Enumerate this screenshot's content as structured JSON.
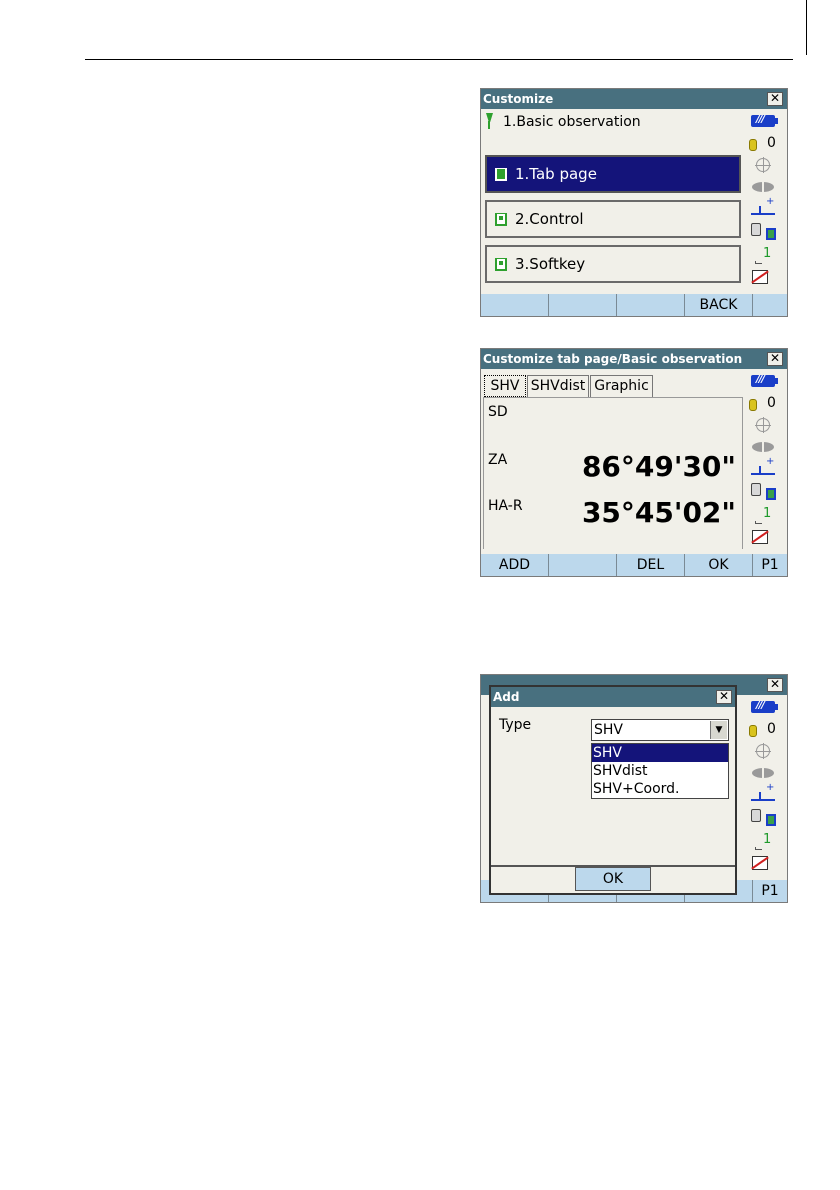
{
  "screen1": {
    "title": "Customize",
    "close_glyph": "✕",
    "header": "1.Basic observation",
    "items": [
      {
        "label": "1.Tab page",
        "selected": true
      },
      {
        "label": "2.Control",
        "selected": false
      },
      {
        "label": "3.Softkey",
        "selected": false
      }
    ],
    "softkeys": [
      "",
      "",
      "",
      "BACK",
      ""
    ]
  },
  "screen2": {
    "title": "Customize tab page/Basic observation",
    "close_glyph": "✕",
    "tabs": [
      "SHV",
      "SHVdist",
      "Graphic"
    ],
    "rows": [
      {
        "label": "SD",
        "value": ""
      },
      {
        "label": "ZA",
        "value": "86°49'30\""
      },
      {
        "label": "HA-R",
        "value": "35°45'02\""
      }
    ],
    "softkeys": [
      "ADD",
      "",
      "DEL",
      "OK",
      "P1"
    ]
  },
  "screen3": {
    "close_glyph": "✕",
    "dialog_title": "Add",
    "dialog_close": "✕",
    "type_label": "Type",
    "type_value": "SHV",
    "type_arrow": "▼",
    "options": [
      {
        "label": "SHV",
        "selected": true
      },
      {
        "label": "SHVdist",
        "selected": false
      },
      {
        "label": "SHV+Coord.",
        "selected": false
      }
    ],
    "ok_label": "OK",
    "softkey_page": "P1"
  },
  "status": {
    "battery_text": "///",
    "prism_constant": "0",
    "target_mark": "+",
    "page_number": "1"
  },
  "colors": {
    "titlebar": "#48707f",
    "selection": "#14147a",
    "softkey": "#bcd8ec",
    "screen_bg": "#f1f0e9"
  }
}
